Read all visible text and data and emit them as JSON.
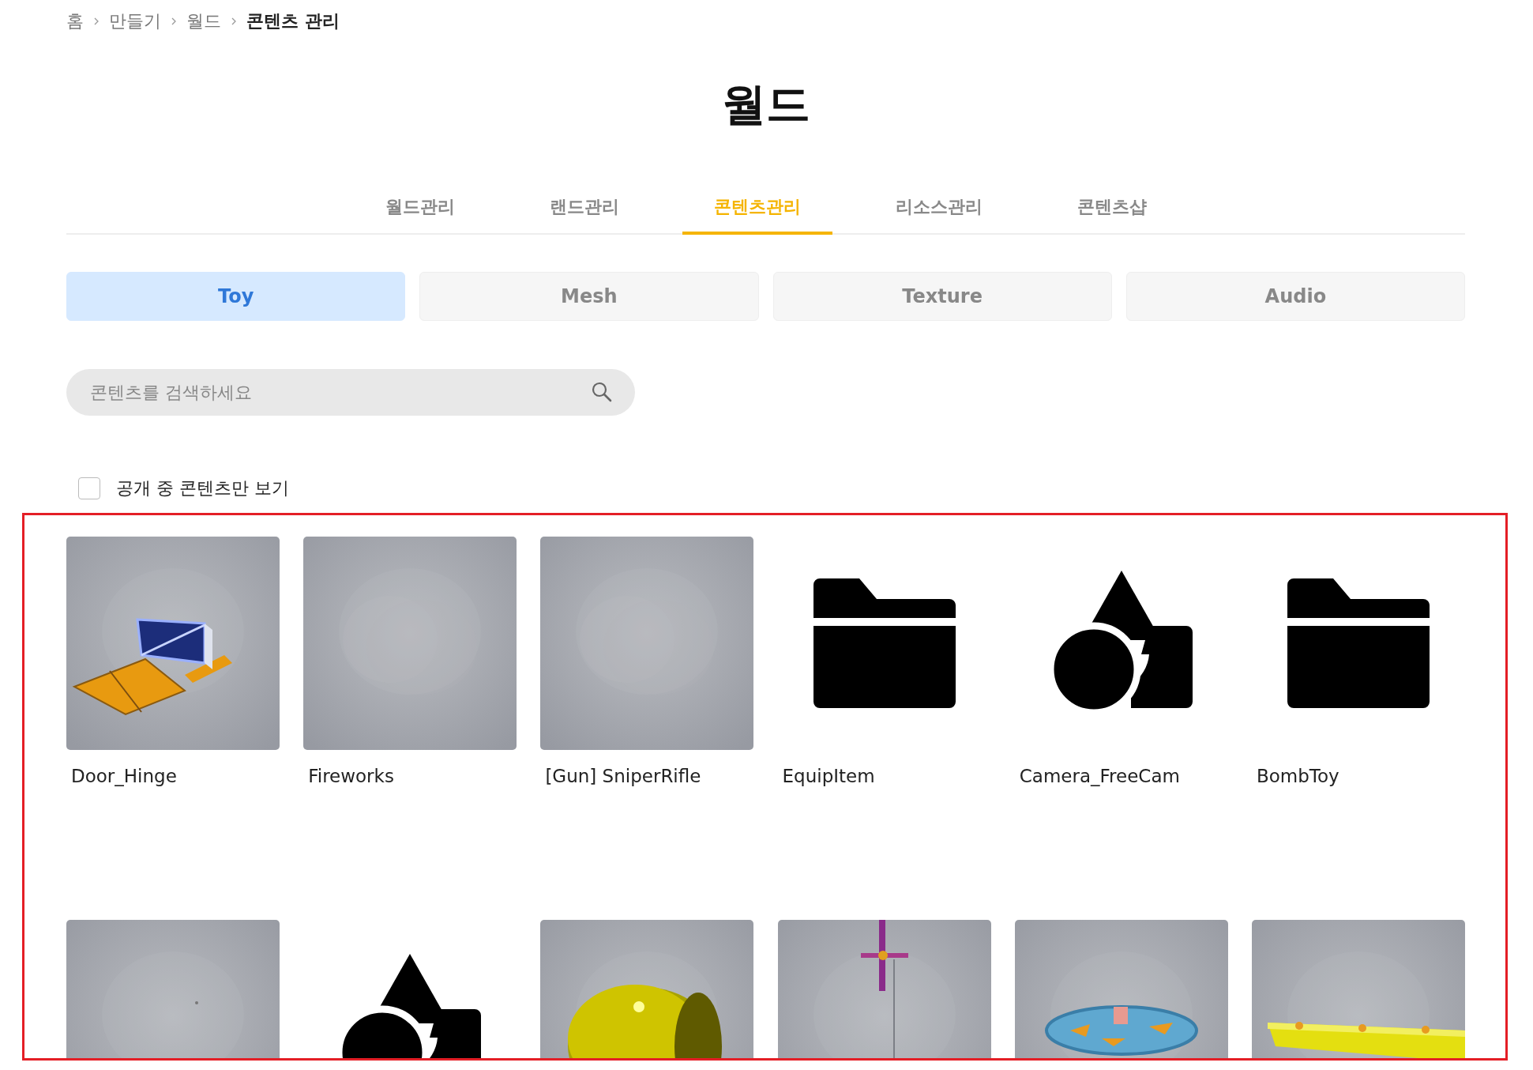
{
  "breadcrumb": [
    {
      "label": "홈",
      "current": false
    },
    {
      "label": "만들기",
      "current": false
    },
    {
      "label": "월드",
      "current": false
    },
    {
      "label": "콘텐츠 관리",
      "current": true
    }
  ],
  "title": "월드",
  "tabs": [
    {
      "label": "월드관리",
      "selected": false
    },
    {
      "label": "랜드관리",
      "selected": false
    },
    {
      "label": "콘텐츠관리",
      "selected": true
    },
    {
      "label": "리소스관리",
      "selected": false
    },
    {
      "label": "콘텐츠샵",
      "selected": false
    }
  ],
  "categories": [
    {
      "label": "Toy",
      "selected": true
    },
    {
      "label": "Mesh",
      "selected": false
    },
    {
      "label": "Texture",
      "selected": false
    },
    {
      "label": "Audio",
      "selected": false
    }
  ],
  "search": {
    "placeholder": "콘텐츠를 검색하세요"
  },
  "public_filter": {
    "label": "공개 중 콘텐츠만 보기",
    "checked": false
  },
  "items": [
    {
      "kind": "picture",
      "name": "Door_Hinge"
    },
    {
      "kind": "picture",
      "name": "Fireworks"
    },
    {
      "kind": "picture",
      "name": "[Gun] SniperRifle"
    },
    {
      "kind": "folder",
      "name": "EquipItem"
    },
    {
      "kind": "shapes",
      "name": "Camera_FreeCam"
    },
    {
      "kind": "folder",
      "name": "BombToy"
    },
    {
      "kind": "picture"
    },
    {
      "kind": "shapes"
    },
    {
      "kind": "picture"
    },
    {
      "kind": "picture"
    },
    {
      "kind": "picture"
    },
    {
      "kind": "picture"
    }
  ]
}
